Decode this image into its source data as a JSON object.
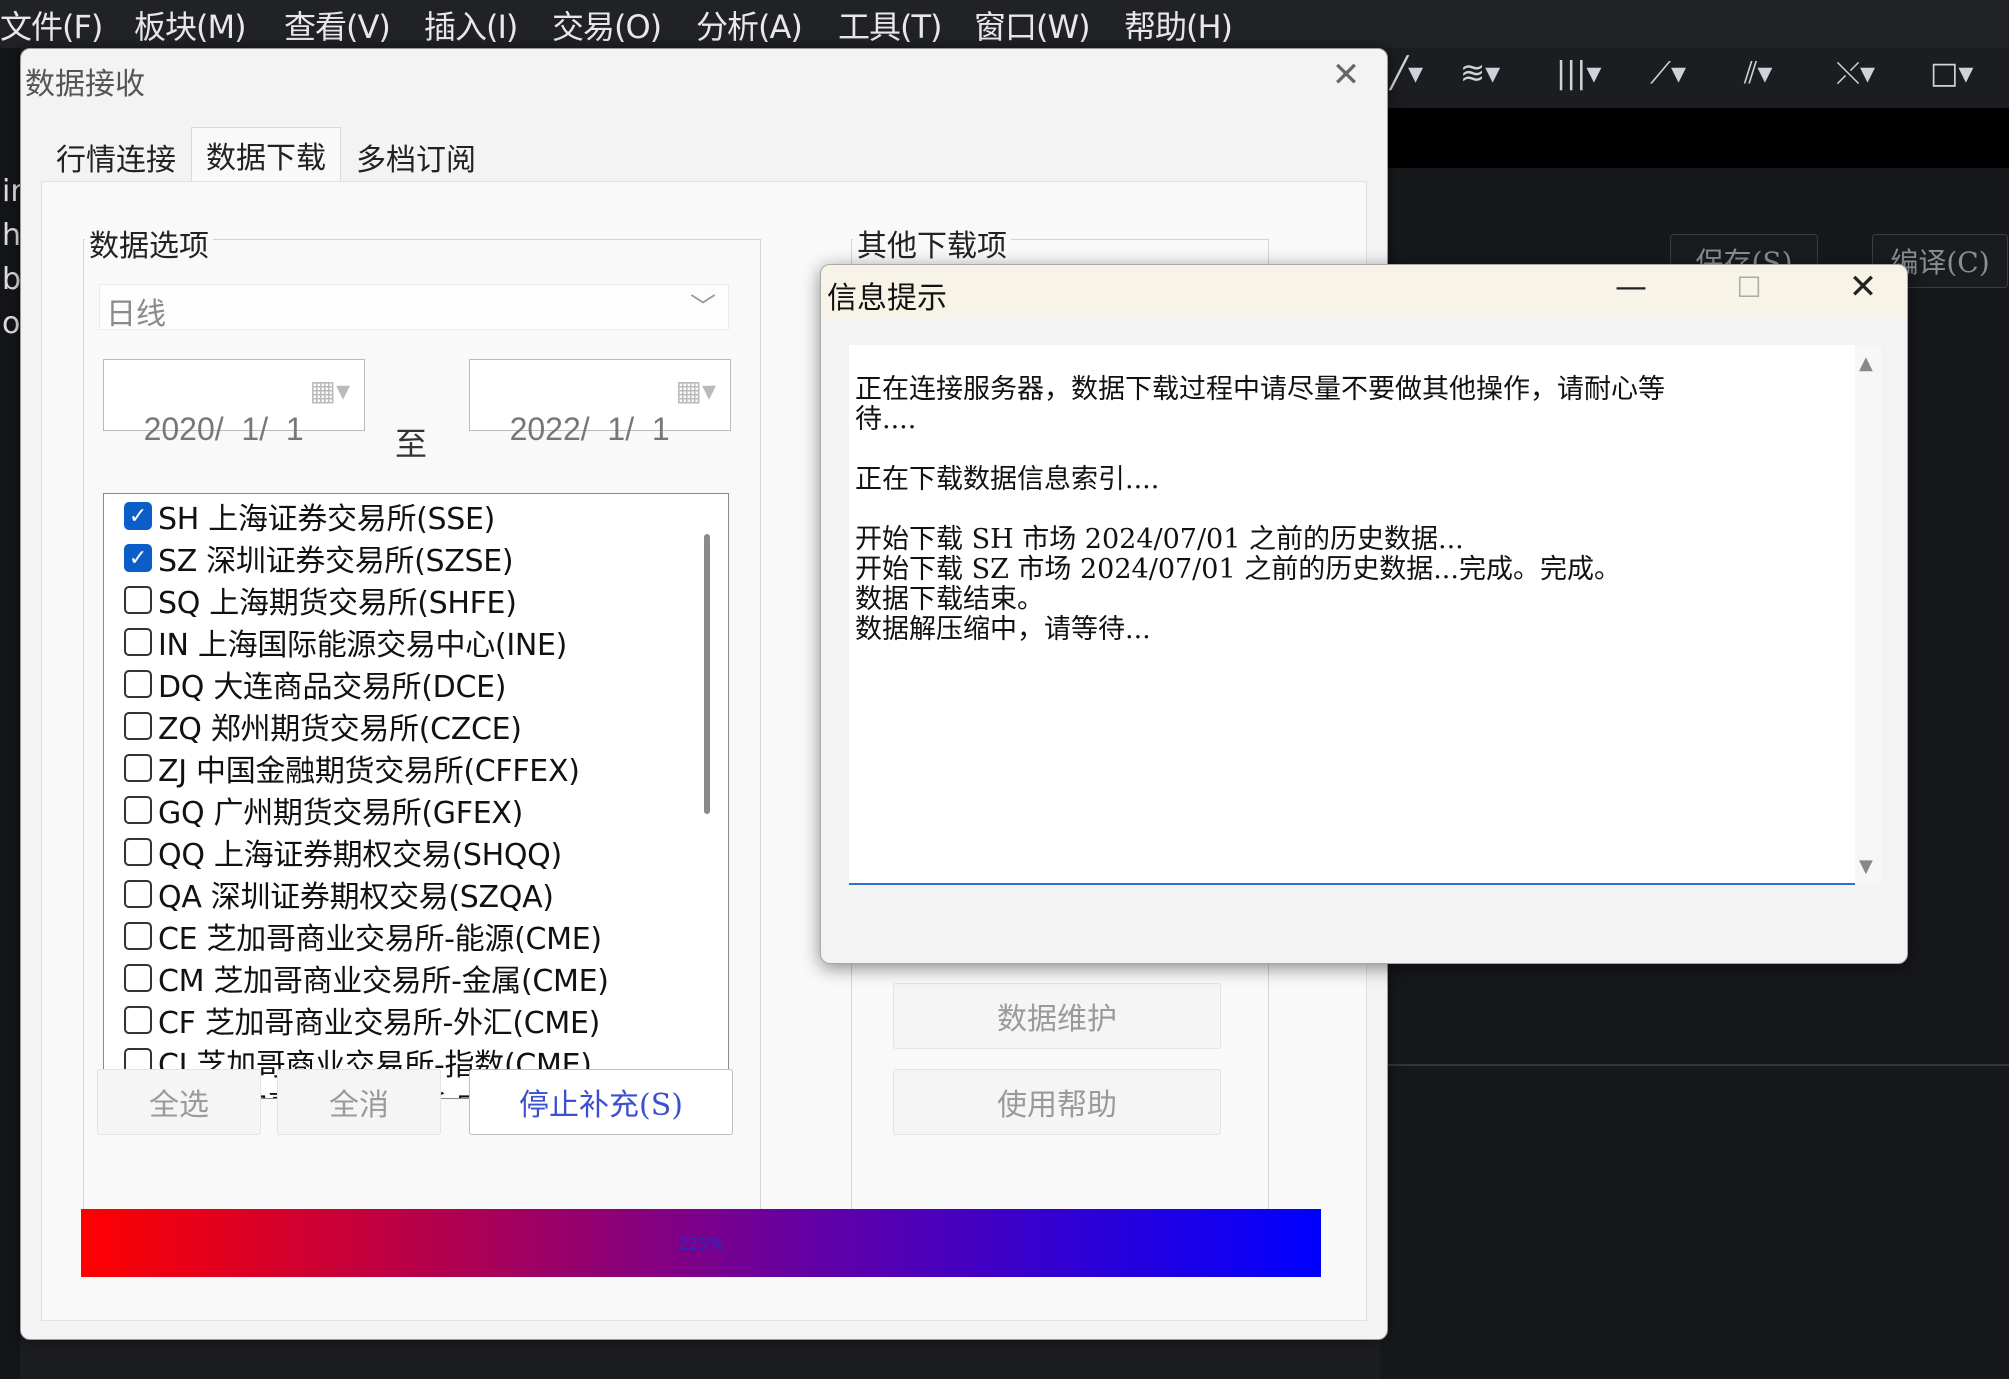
{
  "menu": [
    "文件(F)",
    "板块(M)",
    "查看(V)",
    "插入(I)",
    "交易(O)",
    "分析(A)",
    "工具(T)",
    "窗口(W)",
    "帮助(H)"
  ],
  "left_edge_chars": [
    "ir",
    "h",
    "b",
    "o"
  ],
  "right_panel": {
    "save_label": "保存(S)",
    "compile_label": "编译(C)"
  },
  "dialog": {
    "title": "数据接收",
    "tabs": [
      "行情连接",
      "数据下载",
      "多档订阅"
    ],
    "active_tab": 1,
    "data_options_title": "数据选项",
    "other_downloads_title": "其他下载项",
    "period": "日线",
    "date_from": "2020/  1/  1",
    "date_to_label": "至",
    "date_to": "2022/  1/  1",
    "markets": [
      {
        "label": "SH 上海证券交易所(SSE)",
        "checked": true
      },
      {
        "label": "SZ 深圳证券交易所(SZSE)",
        "checked": true
      },
      {
        "label": "SQ 上海期货交易所(SHFE)",
        "checked": false
      },
      {
        "label": "IN 上海国际能源交易中心(INE)",
        "checked": false
      },
      {
        "label": "DQ 大连商品交易所(DCE)",
        "checked": false
      },
      {
        "label": "ZQ 郑州期货交易所(CZCE)",
        "checked": false
      },
      {
        "label": "ZJ 中国金融期货交易所(CFFEX)",
        "checked": false
      },
      {
        "label": "GQ 广州期货交易所(GFEX)",
        "checked": false
      },
      {
        "label": "QQ 上海证券期权交易(SHQQ)",
        "checked": false
      },
      {
        "label": "QA 深圳证券期权交易(SZQA)",
        "checked": false
      },
      {
        "label": "CE 芝加哥商业交易所-能源(CME)",
        "checked": false
      },
      {
        "label": "CM 芝加哥商业交易所-金属(CME)",
        "checked": false
      },
      {
        "label": "CF 芝加哥商业交易所-外汇(CME)",
        "checked": false
      },
      {
        "label": "CI 芝加哥商业交易所-指数(CME)",
        "checked": false
      },
      {
        "label": "CA 芝加哥商业交易所-农业(CME)",
        "checked": false
      }
    ],
    "select_all": "全选",
    "deselect_all": "全消",
    "stop_button": "停止补充(S)",
    "data_maintenance": "数据维护",
    "help": "使用帮助",
    "progress_text": "225%"
  },
  "info_dialog": {
    "title": "信息提示",
    "lines": [
      "正在连接服务器，数据下载过程中请尽量不要做其他操作，请耐心等",
      "待....",
      "",
      "正在下载数据信息索引....",
      "",
      "开始下载 SH 市场 2024/07/01 之前的历史数据...",
      "开始下载 SZ 市场 2024/07/01 之前的历史数据...完成。完成。",
      "数据下载结束。",
      "数据解压缩中，请等待..."
    ]
  }
}
